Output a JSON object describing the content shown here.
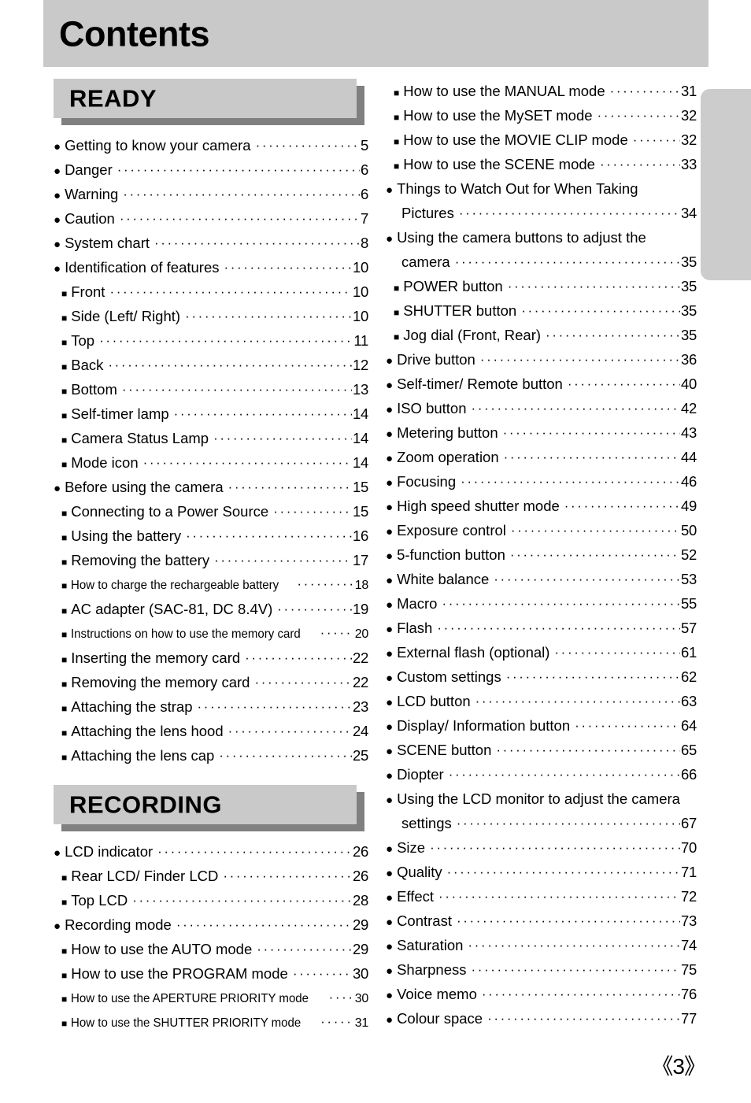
{
  "header": {
    "title": "Contents"
  },
  "page_number": "《3》",
  "colors": {
    "banner_fill": "#c9c9c9",
    "banner_shadow": "#808080",
    "header_band": "#c9c9c9",
    "edge_tab": "#cccccc"
  },
  "icons": {
    "bullet_circle": "●",
    "bullet_square": "■"
  },
  "left_column": {
    "sections": [
      {
        "banner": "READY",
        "entries": [
          {
            "level": 1,
            "label": "Getting to know your camera",
            "page": "5"
          },
          {
            "level": 1,
            "label": "Danger",
            "page": "6"
          },
          {
            "level": 1,
            "label": "Warning",
            "page": "6"
          },
          {
            "level": 1,
            "label": "Caution",
            "page": "7"
          },
          {
            "level": 1,
            "label": "System chart",
            "page": "8"
          },
          {
            "level": 1,
            "label": "Identification of features",
            "page": "10"
          },
          {
            "level": 2,
            "label": "Front",
            "page": "10"
          },
          {
            "level": 2,
            "label": "Side (Left/ Right)",
            "page": "10"
          },
          {
            "level": 2,
            "label": "Top",
            "page": "11"
          },
          {
            "level": 2,
            "label": "Back",
            "page": "12"
          },
          {
            "level": 2,
            "label": "Bottom",
            "page": "13"
          },
          {
            "level": 2,
            "label": "Self-timer lamp",
            "page": "14"
          },
          {
            "level": 2,
            "label": "Camera Status Lamp",
            "page": "14"
          },
          {
            "level": 2,
            "label": "Mode icon",
            "page": "14"
          },
          {
            "level": 1,
            "label": "Before using the camera",
            "page": "15"
          },
          {
            "level": 2,
            "label": "Connecting to a Power Source",
            "page": "15"
          },
          {
            "level": 2,
            "label": "Using the battery",
            "page": "16"
          },
          {
            "level": 2,
            "label": "Removing the battery",
            "page": "17"
          },
          {
            "level": 2,
            "label": "How to charge the rechargeable battery",
            "page": "18",
            "condensed": true
          },
          {
            "level": 2,
            "label": "AC adapter (SAC-81, DC 8.4V)",
            "page": "19"
          },
          {
            "level": 2,
            "label": "Instructions on how to use the memory card",
            "page": "20",
            "condensed": true
          },
          {
            "level": 2,
            "label": "Inserting the memory card",
            "page": "22"
          },
          {
            "level": 2,
            "label": "Removing the memory card",
            "page": "22"
          },
          {
            "level": 2,
            "label": "Attaching the strap",
            "page": "23"
          },
          {
            "level": 2,
            "label": "Attaching the lens hood",
            "page": "24"
          },
          {
            "level": 2,
            "label": "Attaching the lens cap",
            "page": "25"
          }
        ]
      },
      {
        "banner": "RECORDING",
        "entries": [
          {
            "level": 1,
            "label": "LCD indicator",
            "page": "26"
          },
          {
            "level": 2,
            "label": "Rear LCD/ Finder LCD",
            "page": "26"
          },
          {
            "level": 2,
            "label": "Top LCD",
            "page": "28"
          },
          {
            "level": 1,
            "label": "Recording mode",
            "page": "29"
          },
          {
            "level": 2,
            "label": "How to use the AUTO mode",
            "page": "29"
          },
          {
            "level": 2,
            "label": "How to use the PROGRAM mode",
            "page": "30"
          },
          {
            "level": 2,
            "label": "How to use the APERTURE PRIORITY mode",
            "page": "30",
            "condensed": true
          },
          {
            "level": 2,
            "label": "How to use the SHUTTER PRIORITY mode",
            "page": "31",
            "condensed": true
          }
        ]
      }
    ]
  },
  "right_column": {
    "entries": [
      {
        "level": 2,
        "label": "How to use the MANUAL mode",
        "page": "31"
      },
      {
        "level": 2,
        "label": "How to use the MySET mode",
        "page": "32"
      },
      {
        "level": 2,
        "label": "How to use the MOVIE CLIP mode",
        "page": "32"
      },
      {
        "level": 2,
        "label": "How to use the SCENE mode",
        "page": "33"
      },
      {
        "level": 1,
        "label": "Things to Watch Out for When Taking",
        "label2": "Pictures",
        "page": "34",
        "two_line": true
      },
      {
        "level": 1,
        "label": "Using the camera buttons to adjust the",
        "label2": "camera",
        "page": "35",
        "two_line": true
      },
      {
        "level": 2,
        "label": "POWER button",
        "page": "35"
      },
      {
        "level": 2,
        "label": "SHUTTER button",
        "page": "35"
      },
      {
        "level": 2,
        "label": "Jog dial (Front, Rear)",
        "page": "35"
      },
      {
        "level": 1,
        "label": "Drive button",
        "page": "36"
      },
      {
        "level": 1,
        "label": "Self-timer/ Remote button",
        "page": "40"
      },
      {
        "level": 1,
        "label": "ISO button",
        "page": "42"
      },
      {
        "level": 1,
        "label": "Metering button",
        "page": "43"
      },
      {
        "level": 1,
        "label": "Zoom operation",
        "page": "44"
      },
      {
        "level": 1,
        "label": "Focusing",
        "page": "46"
      },
      {
        "level": 1,
        "label": "High speed shutter mode",
        "page": "49"
      },
      {
        "level": 1,
        "label": "Exposure control",
        "page": "50"
      },
      {
        "level": 1,
        "label": "5-function button",
        "page": "52"
      },
      {
        "level": 1,
        "label": "White balance",
        "page": "53"
      },
      {
        "level": 1,
        "label": "Macro",
        "page": "55"
      },
      {
        "level": 1,
        "label": "Flash",
        "page": "57"
      },
      {
        "level": 1,
        "label": "External flash (optional)",
        "page": "61"
      },
      {
        "level": 1,
        "label": "Custom settings",
        "page": "62"
      },
      {
        "level": 1,
        "label": "LCD button",
        "page": "63"
      },
      {
        "level": 1,
        "label": "Display/ Information button",
        "page": "64"
      },
      {
        "level": 1,
        "label": "SCENE button",
        "page": "65"
      },
      {
        "level": 1,
        "label": "Diopter",
        "page": "66"
      },
      {
        "level": 1,
        "label": "Using the LCD monitor to adjust the camera",
        "label2": "settings",
        "page": "67",
        "two_line": true
      },
      {
        "level": 1,
        "label": "Size",
        "page": "70"
      },
      {
        "level": 1,
        "label": "Quality",
        "page": "71"
      },
      {
        "level": 1,
        "label": "Effect",
        "page": "72"
      },
      {
        "level": 1,
        "label": "Contrast",
        "page": "73"
      },
      {
        "level": 1,
        "label": "Saturation",
        "page": "74"
      },
      {
        "level": 1,
        "label": "Sharpness",
        "page": "75"
      },
      {
        "level": 1,
        "label": "Voice memo",
        "page": "76"
      },
      {
        "level": 1,
        "label": "Colour space",
        "page": "77"
      }
    ]
  }
}
